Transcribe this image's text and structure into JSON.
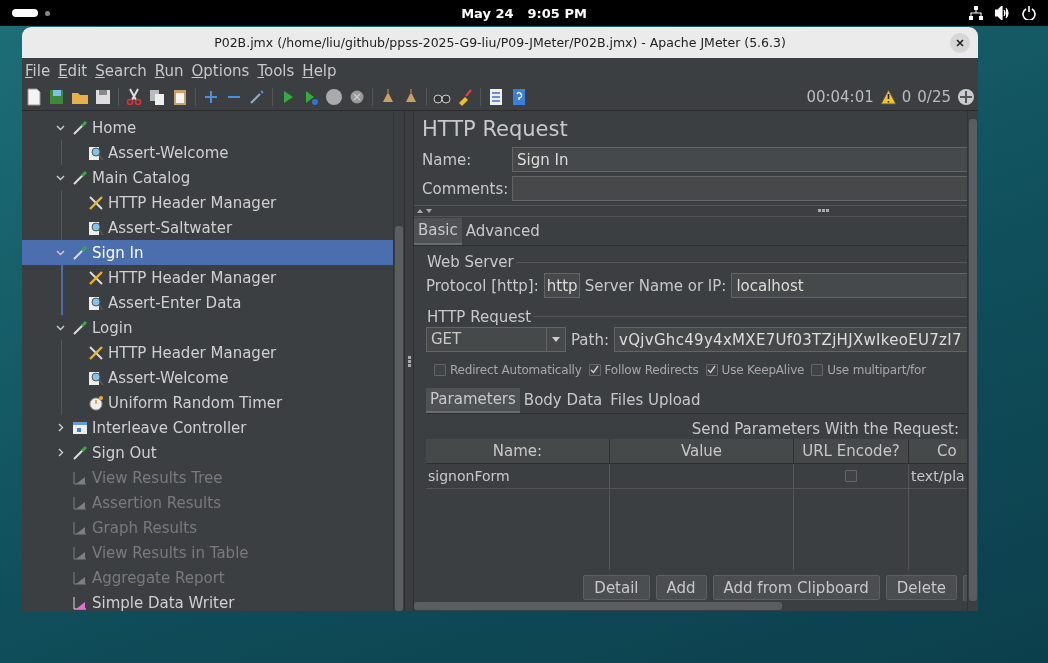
{
  "desktop_bar": {
    "date": "May 24",
    "time": "9:05 PM"
  },
  "window": {
    "title": "P02B.jmx (/home/liu/github/ppss-2025-G9-liu/P09-JMeter/P02B.jmx) - Apache JMeter (5.6.3)"
  },
  "menu": [
    "File",
    "Edit",
    "Search",
    "Run",
    "Options",
    "Tools",
    "Help"
  ],
  "toolbar": {
    "elapsed": "00:04:01",
    "errors": "0",
    "threads": "0/25"
  },
  "tree": [
    {
      "label": "Home",
      "kind": "sampler",
      "expanded": true,
      "selected": false,
      "disabled": false,
      "children": [
        {
          "label": "Assert-Welcome",
          "kind": "assertion",
          "selected": false,
          "disabled": false
        }
      ]
    },
    {
      "label": "Main Catalog",
      "kind": "sampler",
      "expanded": true,
      "selected": false,
      "disabled": false,
      "children": [
        {
          "label": "HTTP Header Manager",
          "kind": "config",
          "selected": false,
          "disabled": false
        },
        {
          "label": "Assert-Saltwater",
          "kind": "assertion",
          "selected": false,
          "disabled": false
        }
      ]
    },
    {
      "label": "Sign In",
      "kind": "sampler",
      "expanded": true,
      "selected": true,
      "disabled": false,
      "children": [
        {
          "label": "HTTP Header Manager",
          "kind": "config",
          "selected": false,
          "disabled": false
        },
        {
          "label": "Assert-Enter Data",
          "kind": "assertion",
          "selected": false,
          "disabled": false
        }
      ]
    },
    {
      "label": "Login",
      "kind": "sampler",
      "expanded": true,
      "selected": false,
      "disabled": false,
      "children": [
        {
          "label": "HTTP Header Manager",
          "kind": "config",
          "selected": false,
          "disabled": false
        },
        {
          "label": "Assert-Welcome",
          "kind": "assertion",
          "selected": false,
          "disabled": false
        },
        {
          "label": "Uniform Random Timer",
          "kind": "timer",
          "selected": false,
          "disabled": false
        }
      ]
    },
    {
      "label": "Interleave Controller",
      "kind": "controller",
      "expanded": false,
      "selected": false,
      "disabled": false
    },
    {
      "label": "Sign Out",
      "kind": "sampler",
      "expanded": false,
      "selected": false,
      "disabled": false
    },
    {
      "label": "View Results Tree",
      "kind": "listener",
      "selected": false,
      "disabled": true
    },
    {
      "label": "Assertion Results",
      "kind": "listener",
      "selected": false,
      "disabled": true
    },
    {
      "label": "Graph Results",
      "kind": "listener",
      "selected": false,
      "disabled": true
    },
    {
      "label": "View Results in Table",
      "kind": "listener",
      "selected": false,
      "disabled": true
    },
    {
      "label": "Aggregate Report",
      "kind": "listener",
      "selected": false,
      "disabled": true
    },
    {
      "label": "Simple Data Writer",
      "kind": "writer",
      "selected": false,
      "disabled": false
    }
  ],
  "editor": {
    "title": "HTTP Request",
    "name_label": "Name:",
    "name": "Sign In",
    "comments_label": "Comments:",
    "tabs": [
      {
        "label": "Basic",
        "selected": true
      },
      {
        "label": "Advanced",
        "selected": false
      }
    ],
    "web_server": {
      "legend": "Web Server",
      "protocol_label": "Protocol [http]:",
      "protocol": "http",
      "server_label": "Server Name or IP:",
      "server": "localhost"
    },
    "http_request": {
      "legend": "HTTP Request",
      "method": "GET",
      "path_label": "Path:",
      "path": "vQjvGhc49y4xMXE7Uf03TZjHJXwIkeoEU7zI7"
    },
    "options": [
      {
        "label": "Redirect Automatically",
        "checked": false
      },
      {
        "label": "Follow Redirects",
        "checked": true
      },
      {
        "label": "Use KeepAlive",
        "checked": true
      },
      {
        "label": "Use multipart/for",
        "checked": false
      }
    ],
    "sub_tabs": [
      {
        "label": "Parameters",
        "selected": true
      },
      {
        "label": "Body Data",
        "selected": false
      },
      {
        "label": "Files Upload",
        "selected": false
      }
    ],
    "params_caption": "Send Parameters With the Request:",
    "table": {
      "columns": [
        "Name:",
        "Value",
        "URL Encode?",
        "Co"
      ],
      "rows": [
        {
          "name": "signonForm",
          "url_encode": false,
          "content_type": "text/pla"
        }
      ]
    },
    "buttons": [
      "Detail",
      "Add",
      "Add from Clipboard",
      "Delete"
    ]
  }
}
